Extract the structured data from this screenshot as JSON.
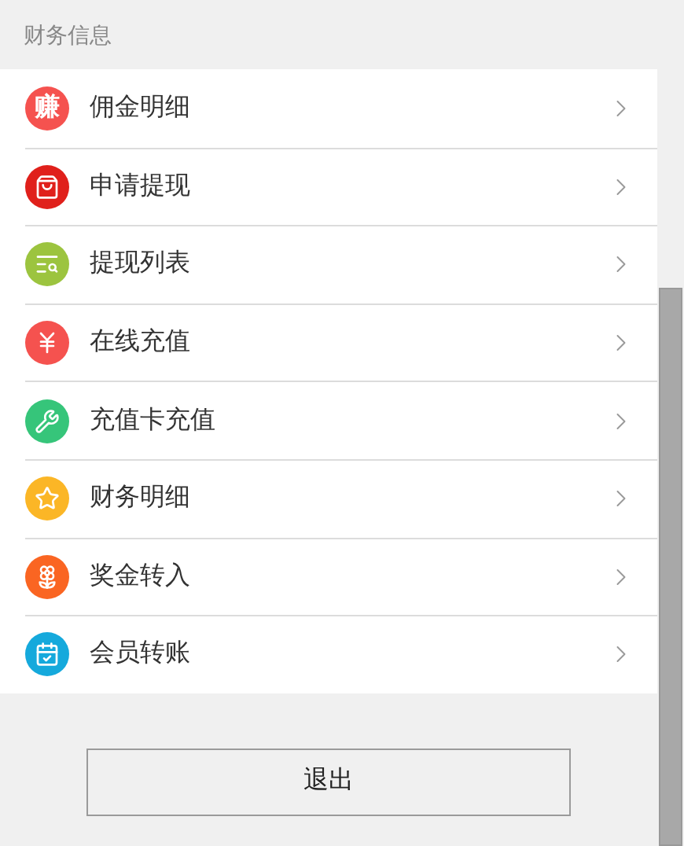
{
  "section_title": "财务信息",
  "items": [
    {
      "label": "佣金明细",
      "glyph": "赚",
      "color": "#f5524f"
    },
    {
      "label": "申请提现",
      "color": "#e0201b"
    },
    {
      "label": "提现列表",
      "color": "#9cc43f"
    },
    {
      "label": "在线充值",
      "color": "#f5524f"
    },
    {
      "label": "充值卡充值",
      "color": "#36c57a"
    },
    {
      "label": "财务明细",
      "color": "#fbb626"
    },
    {
      "label": "奖金转入",
      "color": "#fa6522"
    },
    {
      "label": "会员转账",
      "color": "#15a9dc"
    }
  ],
  "logout_button": "退出"
}
